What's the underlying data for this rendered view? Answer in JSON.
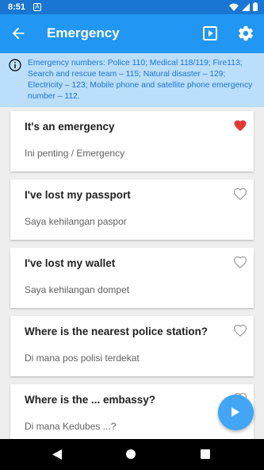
{
  "status_bar": {
    "time": "8:51",
    "notification_glyph": "A"
  },
  "app_bar": {
    "title": "Emergency"
  },
  "info": {
    "text": "Emergency numbers: Police 110; Medical 118/119; Fire113; Search and rescue team – 115; Natural disaster – 129; Electricity – 123; Mobile phone and satellite phone emergency number – 112."
  },
  "phrases": [
    {
      "phrase": "It's an emergency",
      "translation": "Ini penting / Emergency",
      "favorited": true
    },
    {
      "phrase": "I've lost my passport",
      "translation": "Saya kehilangan paspor",
      "favorited": false
    },
    {
      "phrase": "I've lost my wallet",
      "translation": "Saya kehilangan dompet",
      "favorited": false
    },
    {
      "phrase": "Where is the nearest police station?",
      "translation": "Di mana pos polisi terdekat",
      "favorited": false
    },
    {
      "phrase": "Where is the ... embassy?",
      "translation": "Di mana Kedubes ...?",
      "favorited": false
    }
  ],
  "colors": {
    "primary": "#2196f3",
    "status": "#1976d2",
    "banner": "#bbdefb",
    "heart_active": "#e53935",
    "fab": "#42a5f5"
  }
}
